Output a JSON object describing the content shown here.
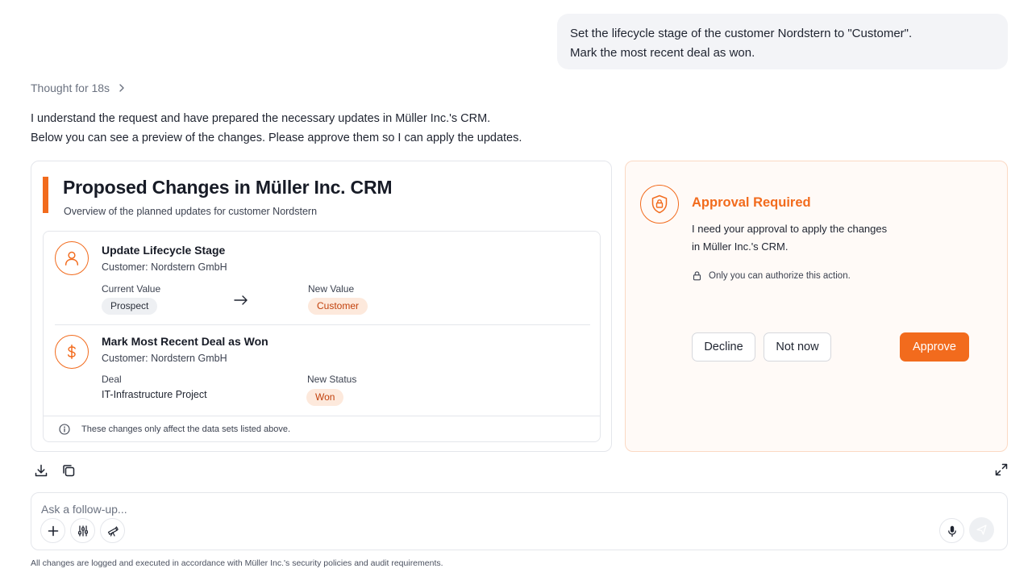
{
  "user_message": {
    "line1": "Set the lifecycle stage of the customer Nordstern to \"Customer\".",
    "line2": "Mark the most recent deal as won."
  },
  "thought": {
    "label": "Thought for 18s",
    "icon": "chevron-right-icon"
  },
  "assistant_reply": {
    "line1": "I understand the request and have prepared the necessary updates in Müller Inc.'s CRM.",
    "line2": "Below you can see a preview of the changes. Please approve them so I can apply the updates."
  },
  "changes_card": {
    "title": "Proposed Changes in Müller Inc. CRM",
    "subtitle": "Overview of the planned updates for customer Nordstern",
    "accent_color": "#f26b1d",
    "changes": [
      {
        "icon": "user-icon",
        "title": "Update Lifecycle Stage",
        "customer": "Customer: Nordstern GmbH",
        "left_label": "Current Value",
        "left_value": "Prospect",
        "right_label": "New Value",
        "right_value": "Customer"
      },
      {
        "icon": "dollar-icon",
        "title": "Mark Most Recent Deal as Won",
        "customer": "Customer: Nordstern GmbH",
        "left_label": "Deal",
        "left_value": "IT-Infrastructure Project",
        "right_label": "New Status",
        "right_value": "Won"
      }
    ],
    "footer_note": "These changes only affect the data sets listed above."
  },
  "approval_card": {
    "icon": "shield-lock-icon",
    "title": "Approval Required",
    "text_line1": "I need your approval to apply the changes",
    "text_line2": "in Müller Inc.'s CRM.",
    "note": "Only you can authorize this action.",
    "buttons": {
      "decline": "Decline",
      "not_now": "Not now",
      "approve": "Approve"
    },
    "accent_color": "#f26b1d"
  },
  "toolbar_icons": [
    "download-icon",
    "copy-icon",
    "expand-icon"
  ],
  "composer": {
    "placeholder": "Ask a follow-up...",
    "buttons": [
      "plus-icon",
      "sliders-icon",
      "telescope-icon",
      "microphone-icon",
      "send-icon"
    ]
  },
  "disclaimer": "All changes are logged and executed in accordance with Müller Inc.'s security policies and audit requirements."
}
